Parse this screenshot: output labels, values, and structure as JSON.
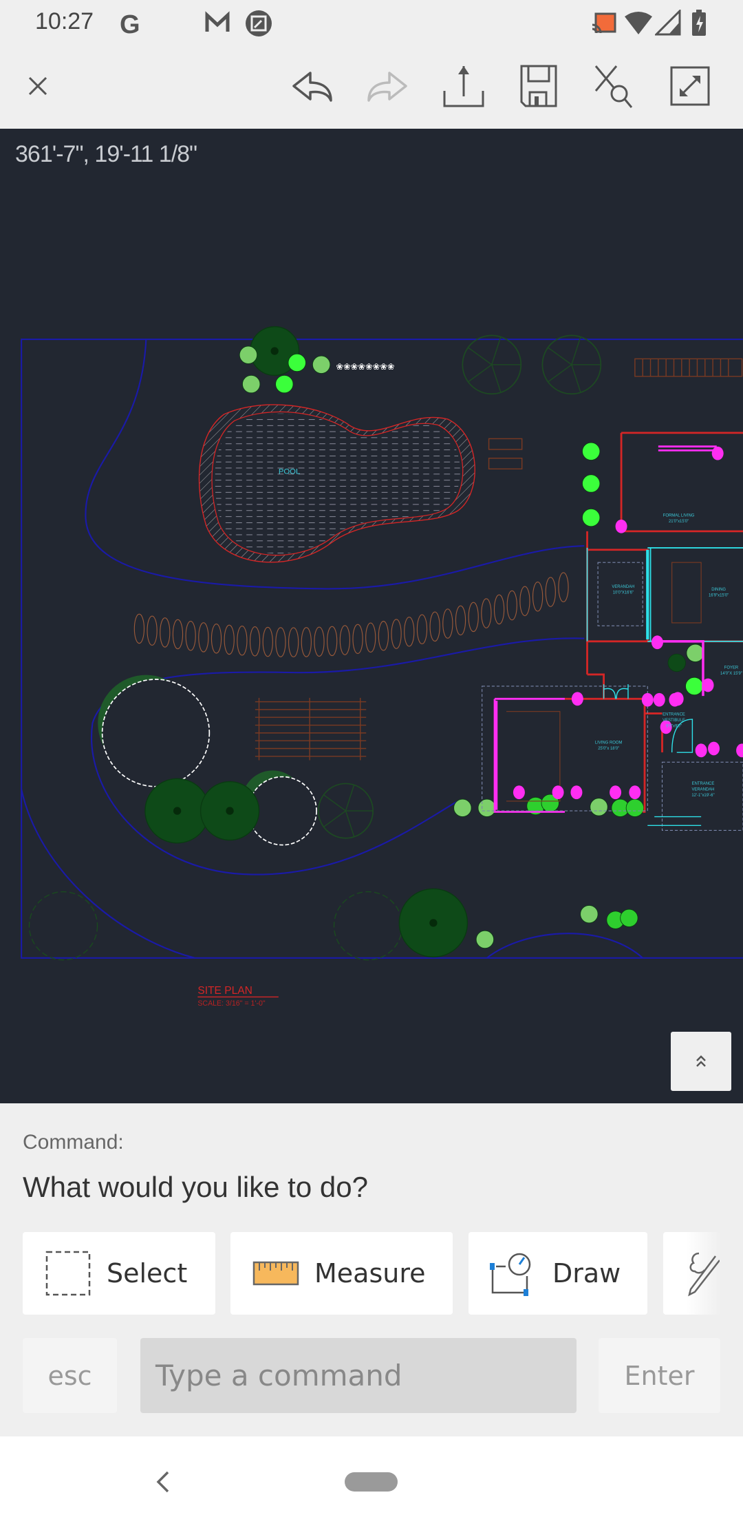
{
  "status_bar": {
    "time": "10:27",
    "left_icons": [
      "google-icon",
      "gmail-icon",
      "screenshot-icon"
    ],
    "right_icons": [
      "cast-icon",
      "wifi-icon",
      "signal-icon",
      "battery-charging-icon"
    ],
    "cast_color": "#f26b3a"
  },
  "toolbar": {
    "close": "close-icon",
    "undo": "undo-icon",
    "redo": "redo-icon",
    "redo_enabled": false,
    "share": "share-icon",
    "save": "save-icon",
    "zoom_extents": "zoom-extents-icon",
    "fullscreen": "fullscreen-icon"
  },
  "canvas": {
    "coordinate_readout": "361'-7\", 19'-11 1/8\"",
    "background": "#222731",
    "pool_label": "POOL",
    "rooms": [
      {
        "name": "FORMAL LIVING",
        "size": "21'0\"x15'0\""
      },
      {
        "name": "VERANDAH",
        "size": "10'0\"X16'6\""
      },
      {
        "name": "DINING",
        "size": "16'9\"x15'0\""
      },
      {
        "name": "FOYER",
        "size": "14'0\"X 15'9\""
      },
      {
        "name": "ENTRANCE",
        "name2": "VESTIBULE",
        "size": "9'0\"x9'0\""
      },
      {
        "name": "LIVING ROOM",
        "size": "25'0\"x 18'0\""
      },
      {
        "name": "ENTRANCE",
        "name2": "VERANDAH",
        "size": "12'-1\"x19'-6\""
      }
    ],
    "title": "SITE PLAN",
    "scale": "SCALE: 3/16\" = 1'-0\"",
    "scroll_up_icon": "double-chevron-up-icon"
  },
  "command_panel": {
    "label": "Command:",
    "prompt": "What would you like to do?",
    "actions": [
      {
        "label": "Select",
        "icon": "select-box-icon"
      },
      {
        "label": "Measure",
        "icon": "ruler-icon"
      },
      {
        "label": "Draw",
        "icon": "draw-icon"
      },
      {
        "label": "",
        "icon": "markup-icon"
      }
    ],
    "esc": "esc",
    "input_placeholder": "Type a command",
    "enter": "Enter"
  },
  "nav_bar": {
    "back": "back-icon",
    "home": "home-pill"
  }
}
